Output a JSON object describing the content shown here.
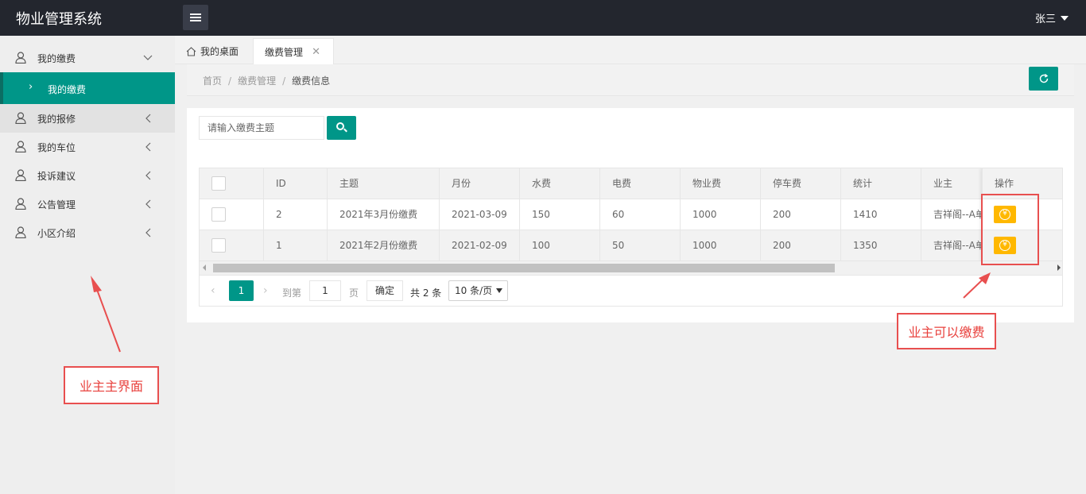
{
  "header": {
    "app_title": "物业管理系统",
    "user_name": "张三"
  },
  "sidebar": {
    "items": [
      {
        "label": "我的缴费",
        "arrow": "﹀"
      },
      {
        "label": "我的报修",
        "arrow": "‹"
      },
      {
        "label": "我的车位",
        "arrow": "‹"
      },
      {
        "label": "投诉建议",
        "arrow": "‹"
      },
      {
        "label": "公告管理",
        "arrow": "‹"
      },
      {
        "label": "小区介绍",
        "arrow": "‹"
      }
    ],
    "sub_item": {
      "label": "我的缴费",
      "chevron": "›"
    }
  },
  "tabs": {
    "home_label": "我的桌面",
    "active_label": "缴费管理",
    "close_glyph": "✕"
  },
  "breadcrumb": {
    "items": [
      "首页",
      "缴费管理",
      "缴费信息"
    ],
    "sep": "/"
  },
  "search": {
    "placeholder": "请输入缴费主题"
  },
  "table": {
    "columns": [
      "ID",
      "主题",
      "月份",
      "水费",
      "电费",
      "物业费",
      "停车费",
      "统计",
      "业主",
      "操作"
    ],
    "rows": [
      {
        "id": "2",
        "subject": "2021年3月份缴费",
        "month": "2021-03-09",
        "water": "150",
        "electric": "60",
        "property": "1000",
        "parking": "200",
        "total": "1410",
        "owner": "吉祥阁--A单元"
      },
      {
        "id": "1",
        "subject": "2021年2月份缴费",
        "month": "2021-02-09",
        "water": "100",
        "electric": "50",
        "property": "1000",
        "parking": "200",
        "total": "1350",
        "owner": "吉祥阁--A单元"
      }
    ],
    "pay_icon": "¥"
  },
  "pager": {
    "prev": "‹",
    "next": "›",
    "current": "1",
    "goto_label": "到第",
    "goto_value": "1",
    "page_unit": "页",
    "confirm": "确定",
    "total": "共 2 条",
    "page_size": "10 条/页"
  },
  "annotations": {
    "main_ui": "业主主界面",
    "can_pay": "业主可以缴费"
  },
  "colors": {
    "accent": "#009688",
    "header_bg": "#23262e",
    "pay_button": "#ffb800",
    "annotation": "#e84f4f"
  }
}
